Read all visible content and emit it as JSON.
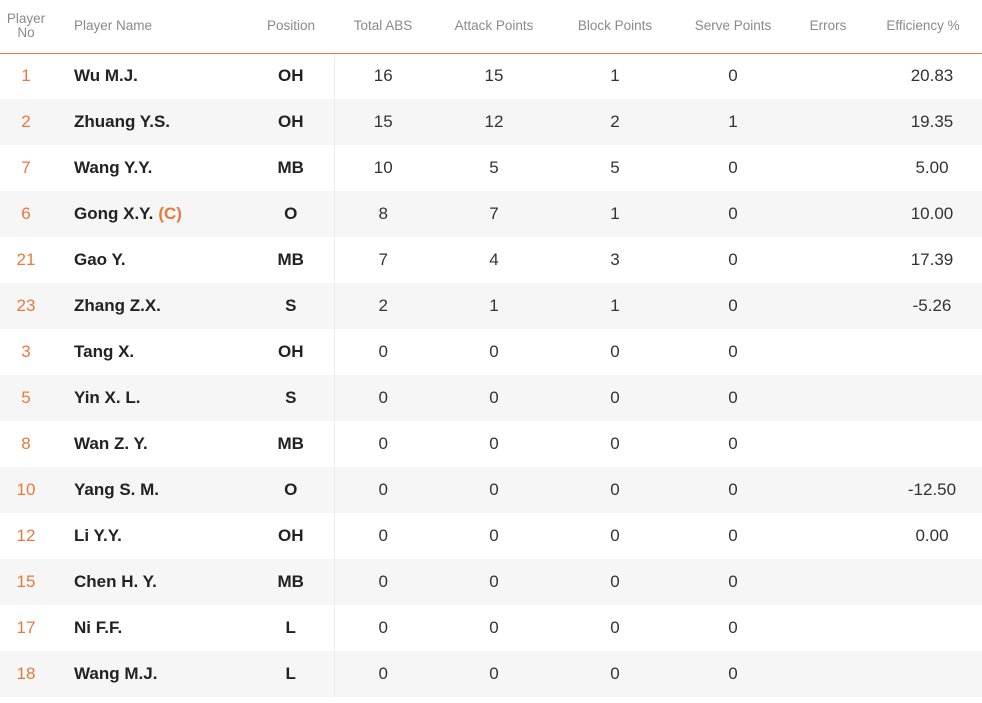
{
  "table": {
    "headers": {
      "player_no": "Player No",
      "player_name": "Player Name",
      "position": "Position",
      "total_abs": "Total ABS",
      "attack_points": "Attack Points",
      "block_points": "Block Points",
      "serve_points": "Serve Points",
      "errors": "Errors",
      "efficiency": "Efficiency %"
    },
    "rows": [
      {
        "no": "1",
        "name": "Wu M.J.",
        "captain": "",
        "pos": "OH",
        "abs": "16",
        "attack": "15",
        "block": "1",
        "serve": "0",
        "errors": "",
        "eff": "20.83"
      },
      {
        "no": "2",
        "name": "Zhuang Y.S.",
        "captain": "",
        "pos": "OH",
        "abs": "15",
        "attack": "12",
        "block": "2",
        "serve": "1",
        "errors": "",
        "eff": "19.35"
      },
      {
        "no": "7",
        "name": "Wang Y.Y.",
        "captain": "",
        "pos": "MB",
        "abs": "10",
        "attack": "5",
        "block": "5",
        "serve": "0",
        "errors": "",
        "eff": "5.00"
      },
      {
        "no": "6",
        "name": "Gong X.Y.",
        "captain": "(C)",
        "pos": "O",
        "abs": "8",
        "attack": "7",
        "block": "1",
        "serve": "0",
        "errors": "",
        "eff": "10.00"
      },
      {
        "no": "21",
        "name": "Gao Y.",
        "captain": "",
        "pos": "MB",
        "abs": "7",
        "attack": "4",
        "block": "3",
        "serve": "0",
        "errors": "",
        "eff": "17.39"
      },
      {
        "no": "23",
        "name": "Zhang Z.X.",
        "captain": "",
        "pos": "S",
        "abs": "2",
        "attack": "1",
        "block": "1",
        "serve": "0",
        "errors": "",
        "eff": "-5.26"
      },
      {
        "no": "3",
        "name": "Tang X.",
        "captain": "",
        "pos": "OH",
        "abs": "0",
        "attack": "0",
        "block": "0",
        "serve": "0",
        "errors": "",
        "eff": ""
      },
      {
        "no": "5",
        "name": "Yin X. L.",
        "captain": "",
        "pos": "S",
        "abs": "0",
        "attack": "0",
        "block": "0",
        "serve": "0",
        "errors": "",
        "eff": ""
      },
      {
        "no": "8",
        "name": "Wan Z. Y.",
        "captain": "",
        "pos": "MB",
        "abs": "0",
        "attack": "0",
        "block": "0",
        "serve": "0",
        "errors": "",
        "eff": ""
      },
      {
        "no": "10",
        "name": "Yang S. M.",
        "captain": "",
        "pos": "O",
        "abs": "0",
        "attack": "0",
        "block": "0",
        "serve": "0",
        "errors": "",
        "eff": "-12.50"
      },
      {
        "no": "12",
        "name": "Li Y.Y.",
        "captain": "",
        "pos": "OH",
        "abs": "0",
        "attack": "0",
        "block": "0",
        "serve": "0",
        "errors": "",
        "eff": "0.00"
      },
      {
        "no": "15",
        "name": "Chen H. Y.",
        "captain": "",
        "pos": "MB",
        "abs": "0",
        "attack": "0",
        "block": "0",
        "serve": "0",
        "errors": "",
        "eff": ""
      },
      {
        "no": "17",
        "name": "Ni F.F.",
        "captain": "",
        "pos": "L",
        "abs": "0",
        "attack": "0",
        "block": "0",
        "serve": "0",
        "errors": "",
        "eff": ""
      },
      {
        "no": "18",
        "name": "Wang M.J.",
        "captain": "",
        "pos": "L",
        "abs": "0",
        "attack": "0",
        "block": "0",
        "serve": "0",
        "errors": "",
        "eff": ""
      }
    ]
  },
  "colors": {
    "accent": "#e8793c",
    "header_text": "#8a8a8a",
    "row_stripe": "#f6f6f6"
  }
}
